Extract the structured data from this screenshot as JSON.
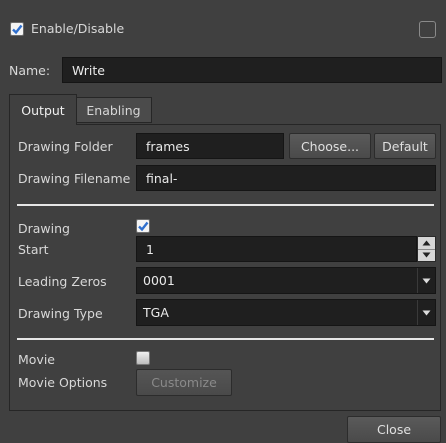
{
  "header": {
    "enable_label": "Enable/Disable"
  },
  "name": {
    "label": "Name:",
    "value": "Write"
  },
  "tabs": [
    {
      "label": "Output"
    },
    {
      "label": "Enabling"
    }
  ],
  "output": {
    "drawing_folder": {
      "label": "Drawing Folder",
      "value": "frames",
      "choose_label": "Choose...",
      "default_label": "Default"
    },
    "drawing_filename": {
      "label": "Drawing Filename",
      "value": "final-"
    },
    "drawing": {
      "label": "Drawing",
      "checked": true
    },
    "start": {
      "label": "Start",
      "value": "1"
    },
    "leading_zeros": {
      "label": "Leading Zeros",
      "value": "0001"
    },
    "drawing_type": {
      "label": "Drawing Type",
      "value": "TGA"
    },
    "movie": {
      "label": "Movie",
      "checked": false
    },
    "movie_options": {
      "label": "Movie Options",
      "button_label": "Customize"
    }
  },
  "footer": {
    "close_label": "Close"
  },
  "icons": {
    "checkbox_checked": "check-icon",
    "spin_up": "arrow-up-icon",
    "spin_down": "arrow-down-icon",
    "dropdown": "chevron-down-icon"
  },
  "colors": {
    "background": "#404040",
    "field": "#1f1f1f",
    "separator": "#e6e6e6"
  }
}
